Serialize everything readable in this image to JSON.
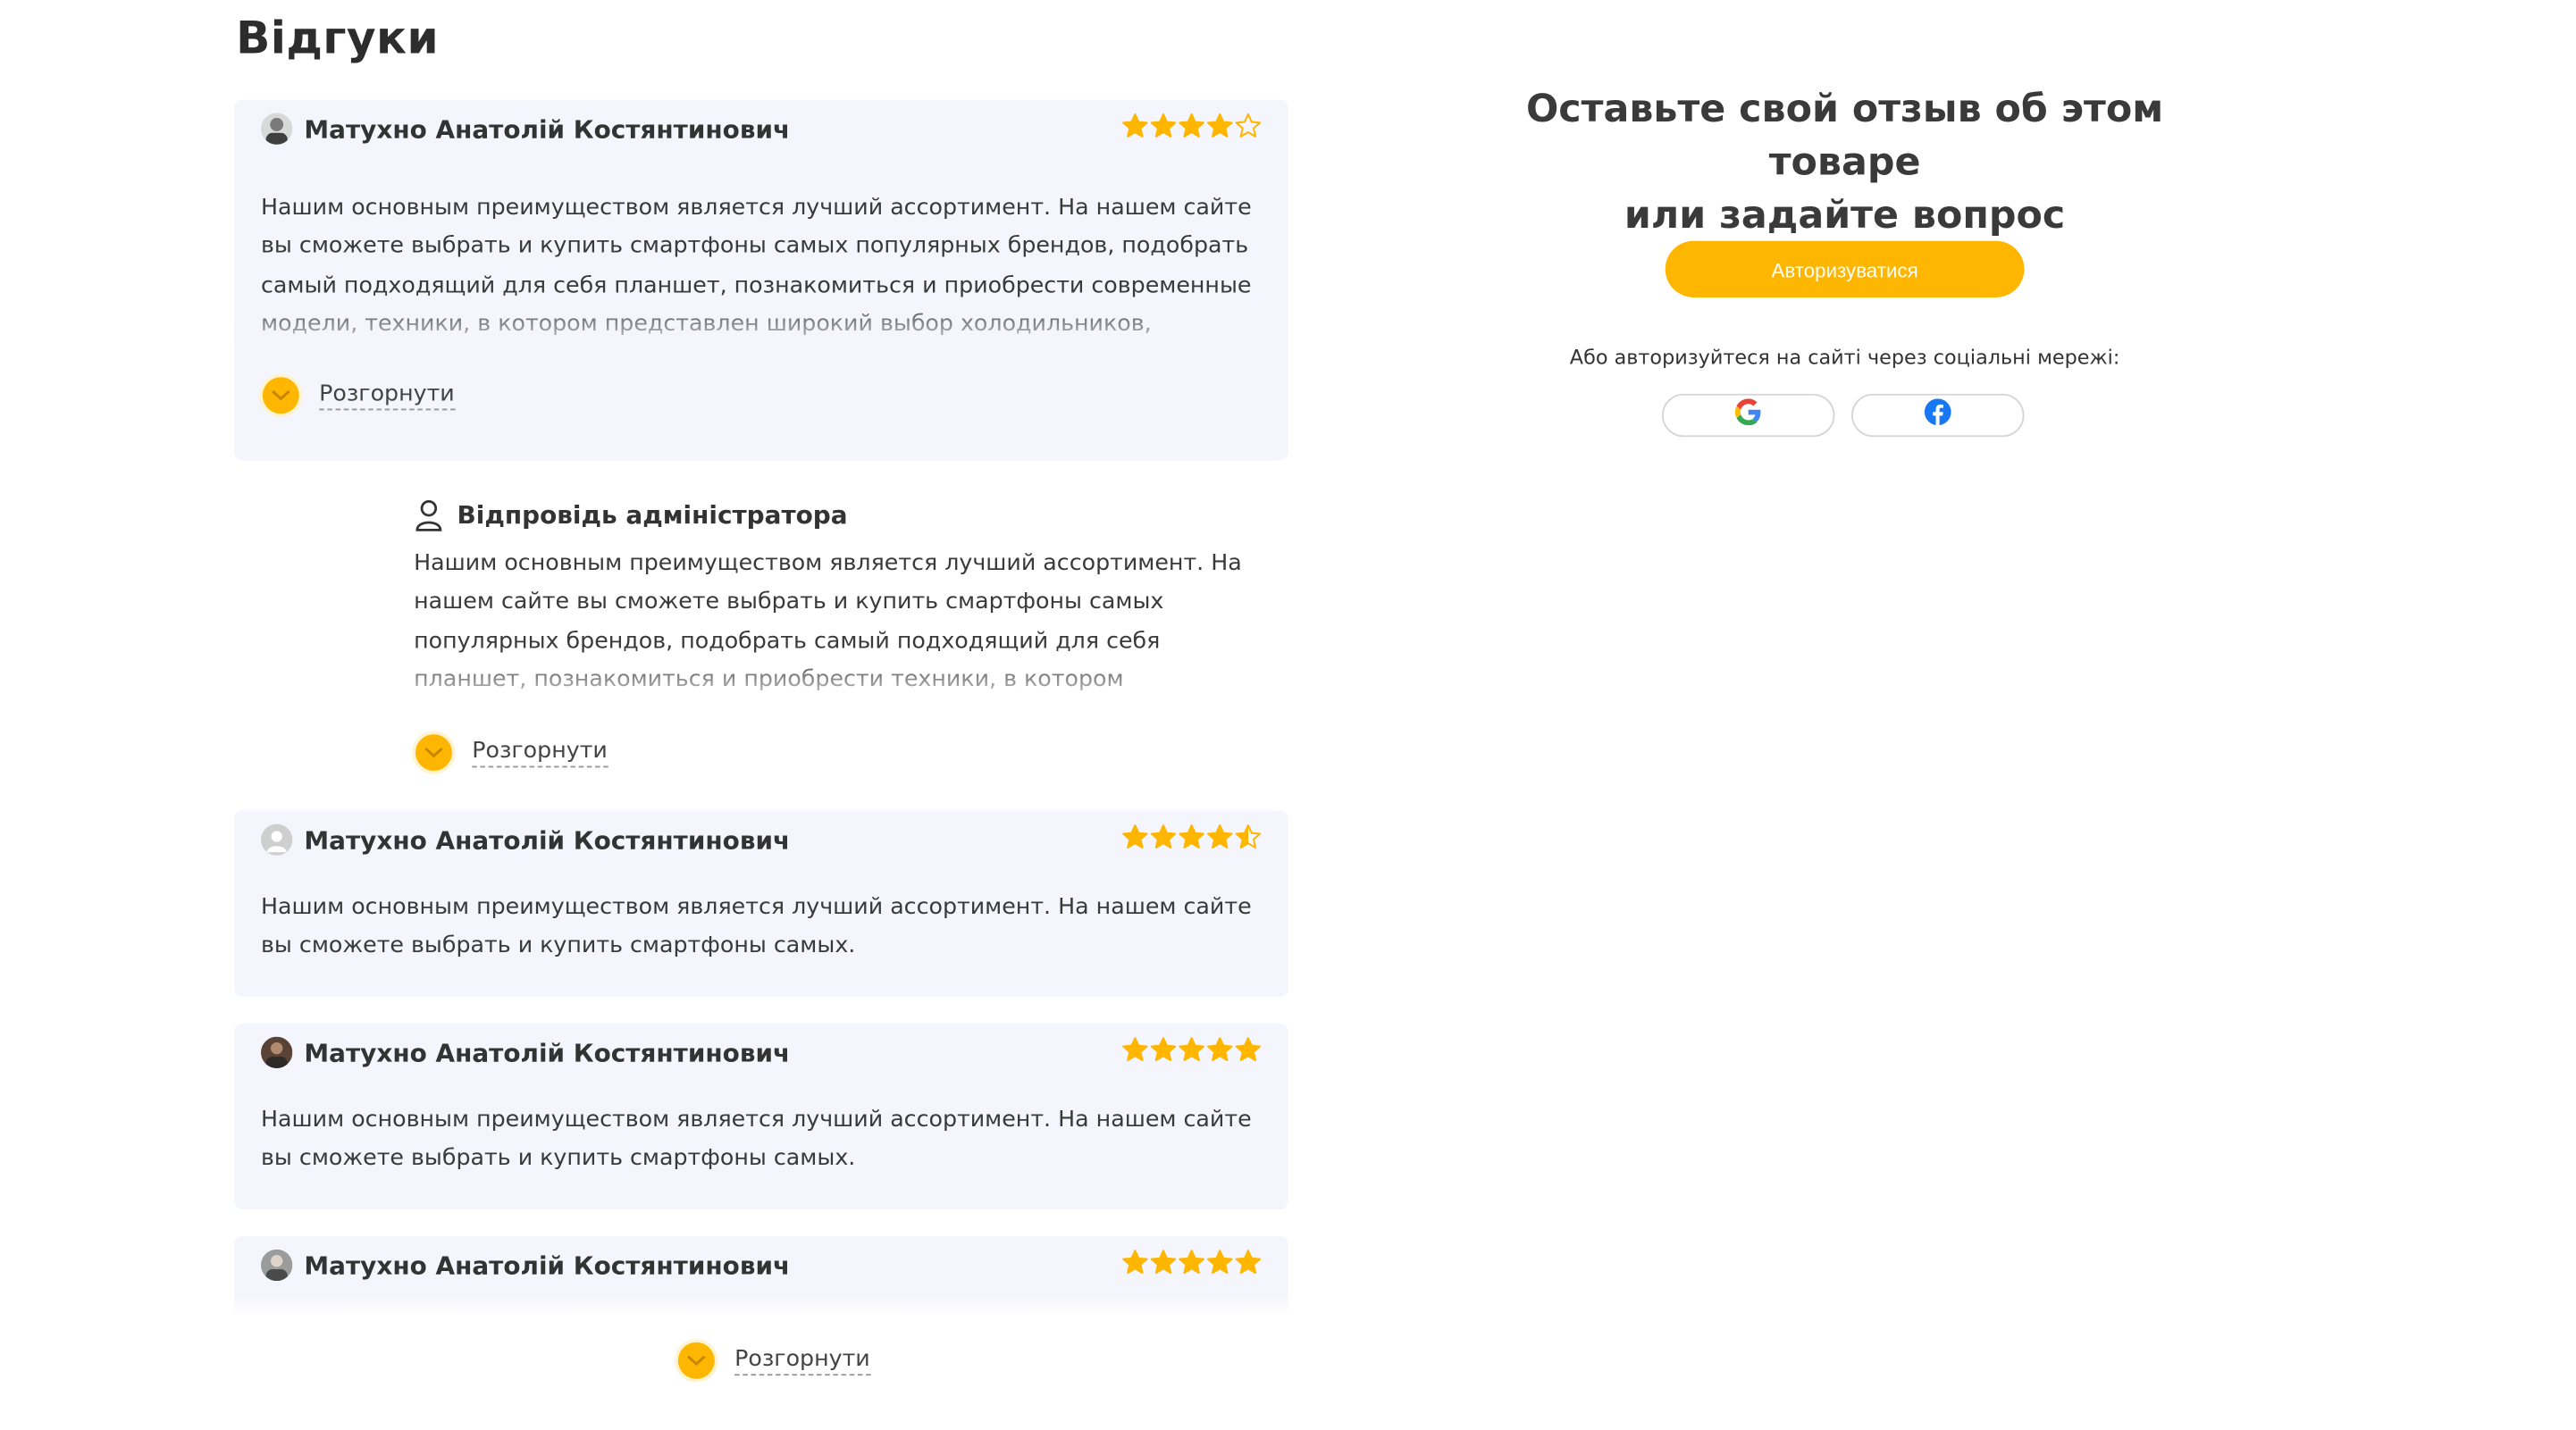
{
  "page": {
    "title": "Відгуки"
  },
  "reviews": [
    {
      "author": "Матухно Анатолій Костянтинович",
      "rating": 4,
      "text": "Нашим основным преимуществом является лучший ассортимент. На нашем сайте вы сможете выбрать и купить смартфоны самых популярных брендов, подобрать самый подходящий для себя планшет, познакомиться и приобрести современные модели, техники, в котором представлен широкий выбор холодильников, стиральных машин печей.",
      "expand_label": "Розгорнути"
    },
    {
      "author": "Матухно Анатолій Костянтинович",
      "rating": 4.5,
      "text": "Нашим основным преимуществом является лучший ассортимент. На нашем сайте вы сможете выбрать и купить смартфоны самых."
    },
    {
      "author": "Матухно Анатолій Костянтинович",
      "rating": 5,
      "text": "Нашим основным преимуществом является лучший ассортимент. На нашем сайте вы сможете выбрать и купить смартфоны самых."
    },
    {
      "author": "Матухно Анатолій Костянтинович",
      "rating": 5
    }
  ],
  "admin_reply": {
    "title": "Відпровідь адміністратора",
    "text": "Нашим основным преимуществом является лучший ассортимент. На нашем сайте вы сможете выбрать и купить смартфоны самых популярных брендов, подобрать самый подходящий для себя планшет, познакомиться и приобрести техники, в котором представлен широкий выбор холодильников, стиральных.",
    "expand_label": "Розгорнути"
  },
  "list_expand_label": "Розгорнути",
  "form": {
    "title_line1": "Оставьте свой отзыв об этом товаре",
    "title_line2": "или задайте вопрос",
    "auth_button": "Авторизуватися",
    "social_note": "Або авторизуйтеся на сайті через соціальні мережі:",
    "social": [
      {
        "icon": "google-icon"
      },
      {
        "icon": "facebook-icon"
      }
    ]
  },
  "colors": {
    "accent": "#ffb600",
    "card_bg": "#f4f5fd",
    "text": "#2d2d2d"
  }
}
